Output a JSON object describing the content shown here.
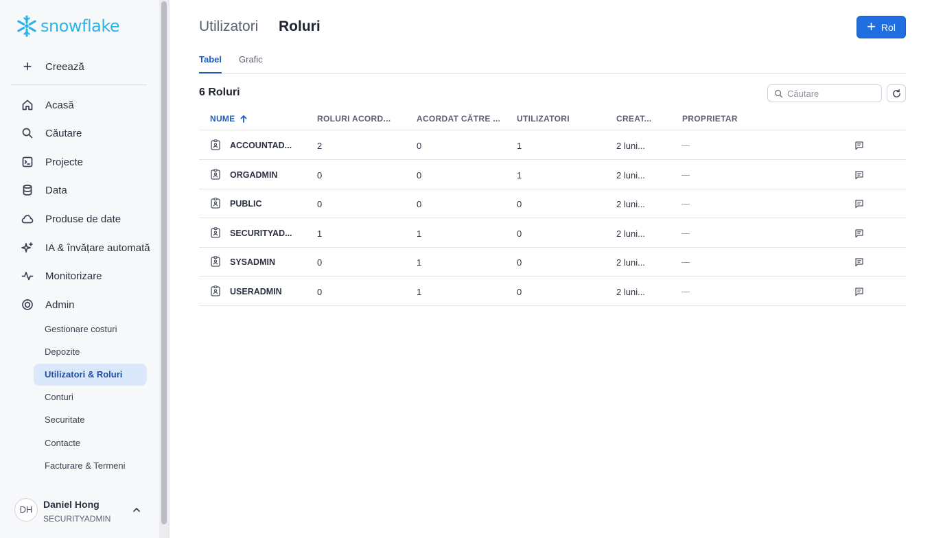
{
  "brand": {
    "name": "snowflake",
    "color": "#29b5e8"
  },
  "sidebar": {
    "create_label": "Creează",
    "items": [
      {
        "label": "Acasă",
        "icon": "home-icon"
      },
      {
        "label": "Căutare",
        "icon": "search-icon"
      },
      {
        "label": "Projecte",
        "icon": "projects-icon"
      },
      {
        "label": "Data",
        "icon": "database-icon"
      },
      {
        "label": "Produse de date",
        "icon": "cloud-icon"
      },
      {
        "label": "IA & învățare automată",
        "icon": "sparkle-icon"
      },
      {
        "label": "Monitorizare",
        "icon": "activity-icon"
      },
      {
        "label": "Admin",
        "icon": "shield-icon"
      }
    ],
    "admin_subitems": [
      {
        "label": "Gestionare costuri"
      },
      {
        "label": "Depozite"
      },
      {
        "label": "Utilizatori & Roluri",
        "active": true
      },
      {
        "label": "Conturi"
      },
      {
        "label": "Securitate"
      },
      {
        "label": "Contacte"
      },
      {
        "label": "Facturare & Termeni"
      }
    ],
    "user": {
      "initials": "DH",
      "name": "Daniel Hong",
      "role": "SECURITYADMIN"
    }
  },
  "header": {
    "title_inactive": "Utilizatori",
    "title_active": "Roluri",
    "add_button_label": "Rol",
    "accent_color": "#1f6fe0"
  },
  "tabs": [
    {
      "label": "Tabel",
      "active": true
    },
    {
      "label": "Grafic",
      "active": false
    }
  ],
  "table": {
    "count_label": "6 Roluri",
    "search_placeholder": "Căutare",
    "columns": [
      "NUME",
      "ROLURI ACORD...",
      "ACORDAT CĂTRE ...",
      "UTILIZATORI",
      "CREAT...",
      "PROPRIETAR"
    ],
    "sorted_column": "NUME",
    "rows": [
      {
        "name": "ACCOUNTAD...",
        "granted_roles": "2",
        "granted_to": "0",
        "users": "1",
        "created": "2 luni..."
      },
      {
        "name": "ORGADMIN",
        "granted_roles": "0",
        "granted_to": "0",
        "users": "1",
        "created": "2 luni..."
      },
      {
        "name": "PUBLIC",
        "granted_roles": "0",
        "granted_to": "0",
        "users": "0",
        "created": "2 luni..."
      },
      {
        "name": "SECURITYAD...",
        "granted_roles": "1",
        "granted_to": "1",
        "users": "0",
        "created": "2 luni..."
      },
      {
        "name": "SYSADMIN",
        "granted_roles": "0",
        "granted_to": "1",
        "users": "0",
        "created": "2 luni..."
      },
      {
        "name": "USERADMIN",
        "granted_roles": "0",
        "granted_to": "1",
        "users": "0",
        "created": "2 luni..."
      }
    ]
  }
}
